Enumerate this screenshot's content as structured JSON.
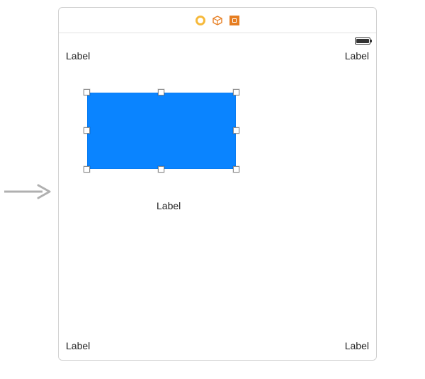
{
  "labels": {
    "top_left": "Label",
    "top_right": "Label",
    "bottom_left": "Label",
    "bottom_right": "Label",
    "center": "Label"
  },
  "selected_view": {
    "type": "UIView",
    "background_color": "#0a84ff"
  },
  "icons": {
    "titlebar_left": "interface-builder-ambiguous-icon",
    "titlebar_mid": "interface-builder-3d-icon",
    "titlebar_right": "interface-builder-square-icon"
  }
}
